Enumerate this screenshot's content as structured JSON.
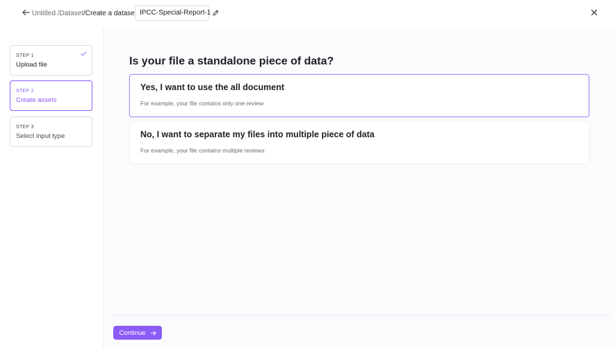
{
  "header": {
    "breadcrumb_root": "Untitled",
    "breadcrumb_dataset": "/Dataset",
    "breadcrumb_current": "/Create a dataset",
    "dataset_name": "IPCC-Special-Report-1",
    "icons": {
      "back": "arrow-left-icon",
      "edit": "pencil-icon",
      "close": "close-icon"
    }
  },
  "steps": [
    {
      "number": "STEP 1",
      "label": "Upload file",
      "state": "done"
    },
    {
      "number": "STEP 2",
      "label": "Create assets",
      "state": "active"
    },
    {
      "number": "STEP 3",
      "label": "Select input type",
      "state": "pending"
    }
  ],
  "main": {
    "question": "Is your file a standalone piece of data?",
    "options": [
      {
        "title": "Yes, I want to use the all document",
        "description": "For example, your file contains only one review",
        "selected": true
      },
      {
        "title": "No, I want to separate my files into multiple piece of data",
        "description": "For example, your file contains multiple reviews",
        "selected": false
      }
    ]
  },
  "footer": {
    "continue_label": "Continue"
  },
  "colors": {
    "accent": "#8b5cf6",
    "background": "#fbfafd"
  }
}
